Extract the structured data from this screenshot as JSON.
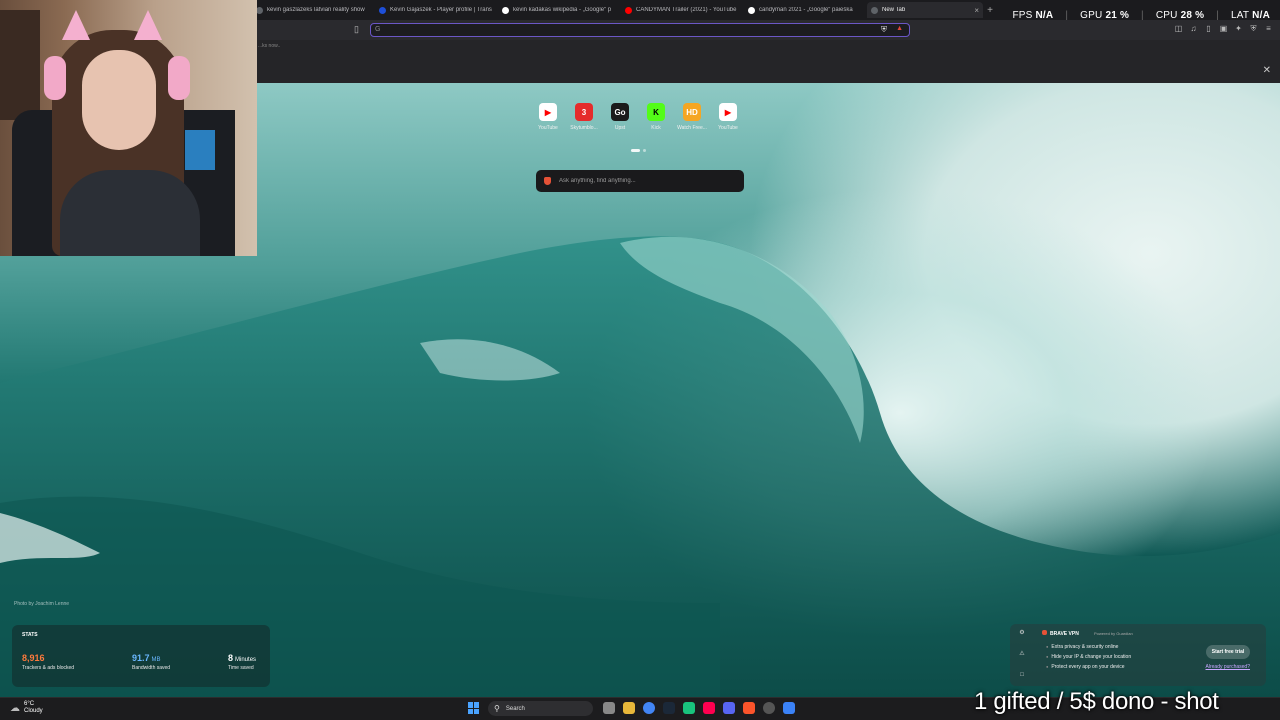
{
  "browser": {
    "tabs": [
      {
        "title": "kevin gaszlazeks latvian reality show",
        "favicon_color": "#5f6368"
      },
      {
        "title": "Kevin Gajaszek - Player profile | Trans",
        "favicon_color": "#1e4fd8"
      },
      {
        "title": "kevin kadakas wikipedia - „Google“ p",
        "favicon_color": "#ffffff"
      },
      {
        "title": "CANDYMAN Trailer (2021) - YouTube",
        "favicon_color": "#ff0000"
      },
      {
        "title": "candyman 2021 - „Google“ paieška",
        "favicon_color": "#ffffff"
      },
      {
        "title": "New Tab",
        "favicon_color": "#5f6368",
        "active": true
      }
    ],
    "new_tab_symbol": "+",
    "address_bar": {
      "value": "",
      "g_mark": "G"
    },
    "bookmarks_more": "...ks now.."
  },
  "perf": {
    "fps_label": "FPS",
    "fps_value": "N/A",
    "gpu_label": "GPU",
    "gpu_value": "21 %",
    "cpu_label": "CPU",
    "cpu_value": "28 %",
    "lat_label": "LAT",
    "lat_value": "N/A"
  },
  "newtab": {
    "top_sites": [
      {
        "label": "YouTube",
        "glyph": "▶",
        "color": "#ff0000",
        "icon": "youtube-icon"
      },
      {
        "label": "Skytumblo...",
        "glyph": "3",
        "color": "#e52b2b",
        "icon": "site3-icon"
      },
      {
        "label": "Upst",
        "glyph": "Go",
        "color": "#1b1b1b",
        "icon": "go-icon"
      },
      {
        "label": "Kick",
        "glyph": "K",
        "color": "#53fc18",
        "icon": "kick-icon"
      },
      {
        "label": "Watch Free...",
        "glyph": "HD",
        "color": "#f5a623",
        "icon": "hd-icon"
      },
      {
        "label": "YouTube",
        "glyph": "▶",
        "color": "#ff0000",
        "icon": "youtube-icon"
      }
    ],
    "search_placeholder": "Ask anything, find anything...",
    "photo_credit": "Photo by Joachim Lenne",
    "stats": {
      "heading": "STATS",
      "trackers_value": "8,916",
      "trackers_desc": "Trackers & ads blocked",
      "trackers_color": "#ff7a3d",
      "bandwidth_value": "91.7",
      "bandwidth_unit": "MB",
      "bandwidth_desc": "Bandwidth saved",
      "bandwidth_color": "#6ab7ff",
      "time_value": "8",
      "time_unit": "Minutes",
      "time_desc": "Time saved"
    },
    "vpn": {
      "brand": "BRAVE VPN",
      "powered_by": "Powered by Guardian",
      "features": [
        "Extra privacy & security online",
        "Hide your IP & change your location",
        "Protect every app on your device"
      ],
      "cta": "Start free trial",
      "already": "Already purchased?"
    }
  },
  "taskbar": {
    "weather_temp": "6°C",
    "weather_desc": "Cloudy",
    "search_label": "Search"
  },
  "overlay": {
    "caption": "1 gifted / 5$ dono - shot"
  }
}
